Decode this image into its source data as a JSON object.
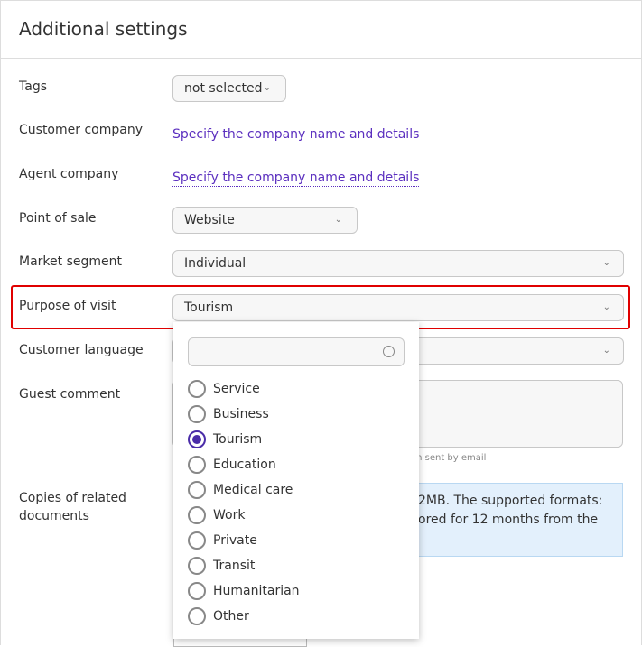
{
  "title": "Additional settings",
  "fields": {
    "tags": {
      "label": "Tags",
      "value": "not selected"
    },
    "customer_company": {
      "label": "Customer company",
      "link": "Specify the company name and details"
    },
    "agent_company": {
      "label": "Agent company",
      "link": "Specify the company name and details"
    },
    "point_of_sale": {
      "label": "Point of sale",
      "value": "Website"
    },
    "market_segment": {
      "label": "Market segment",
      "value": "Individual"
    },
    "purpose_of_visit": {
      "label": "Purpose of visit",
      "value": "Tourism"
    },
    "customer_language": {
      "label": "Customer language"
    },
    "guest_comment": {
      "label": "Guest comment",
      "hint": "on sent by email"
    },
    "copies": {
      "label": "Copies of related documents",
      "info_line1": "2MB. The supported formats:",
      "info_line2": "ored for 12 months from the"
    }
  },
  "dropdown": {
    "search_placeholder": "",
    "options": [
      "Service",
      "Business",
      "Tourism",
      "Education",
      "Medical care",
      "Work",
      "Private",
      "Transit",
      "Humanitarian",
      "Other"
    ],
    "selected": "Tourism"
  },
  "colors": {
    "accent": "#4a2ca8",
    "link": "#5b2fbf",
    "highlight": "#e00000",
    "info_bg": "#e3f0fc"
  }
}
